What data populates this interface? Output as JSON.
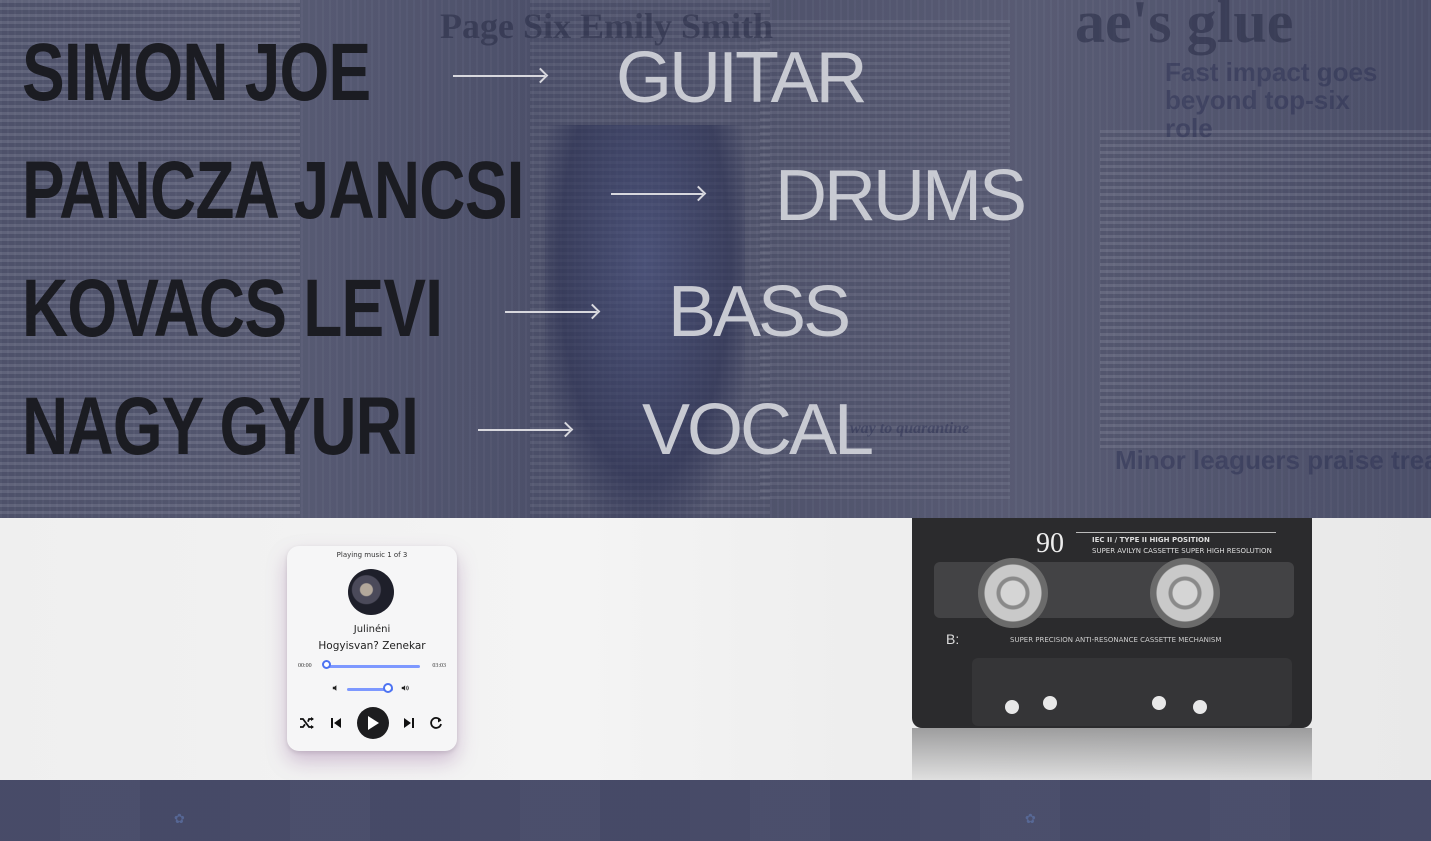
{
  "band": {
    "members": [
      {
        "name": "SIMON JOE",
        "instrument": "GUITAR"
      },
      {
        "name": "PANCZA JANCSI",
        "instrument": "DRUMS"
      },
      {
        "name": "KOVACS LEVI",
        "instrument": "BASS"
      },
      {
        "name": "NAGY GYURI",
        "instrument": "VOCAL"
      }
    ]
  },
  "background_text": {
    "headline_top_left": "Page Six Emily Smith",
    "headline_top_right": "ae's glue",
    "subhead_right": "Fast impact goes beyond top-six role",
    "headline_bottom_right": "Minor leaguers praise treatment",
    "caption_bottom_mid": "way to quarantine"
  },
  "cassette": {
    "number": "90",
    "label_line1": "IEC II / TYPE II  HIGH POSITION",
    "label_line2": "SUPER AVILYN CASSETTE SUPER HIGH RESOLUTION",
    "side": "B:",
    "mechanism": "SUPER PRECISION ANTI-RESONANCE CASSETTE MECHANISM"
  },
  "player": {
    "status": "Playing music 1 of 3",
    "artist": "Julinéni",
    "title": "Hogyisvan? Zenekar",
    "time_current": "00:00",
    "time_total": "03:03",
    "progress": 0.0,
    "volume": 0.9,
    "icons": {
      "volume_low": "volume-low-icon",
      "volume_high": "volume-high-icon",
      "shuffle": "shuffle-icon",
      "previous": "skip-previous-icon",
      "play": "play-icon",
      "next": "skip-next-icon",
      "repeat": "repeat-icon"
    },
    "accent_color": "#4d73f2"
  }
}
